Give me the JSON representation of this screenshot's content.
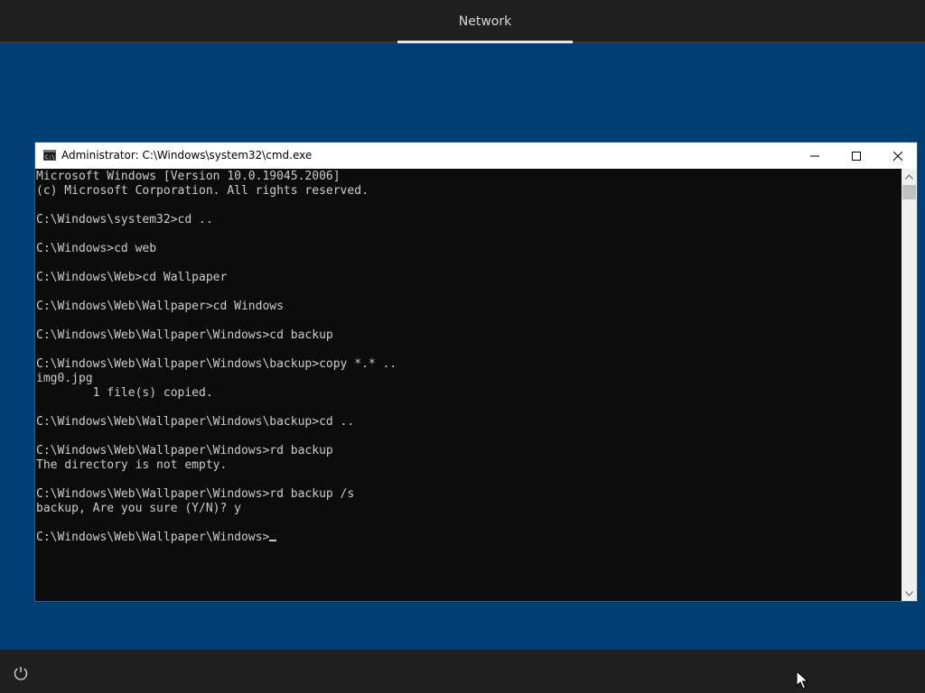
{
  "topbar": {
    "tab_label": "Network"
  },
  "window": {
    "title": "Administrator: C:\\Windows\\system32\\cmd.exe",
    "icon": "cmd-icon"
  },
  "console": {
    "lines": [
      "Microsoft Windows [Version 10.0.19045.2006]",
      "(c) Microsoft Corporation. All rights reserved.",
      "",
      "C:\\Windows\\system32>cd ..",
      "",
      "C:\\Windows>cd web",
      "",
      "C:\\Windows\\Web>cd Wallpaper",
      "",
      "C:\\Windows\\Web\\Wallpaper>cd Windows",
      "",
      "C:\\Windows\\Web\\Wallpaper\\Windows>cd backup",
      "",
      "C:\\Windows\\Web\\Wallpaper\\Windows\\backup>copy *.* ..",
      "img0.jpg",
      "        1 file(s) copied.",
      "",
      "C:\\Windows\\Web\\Wallpaper\\Windows\\backup>cd ..",
      "",
      "C:\\Windows\\Web\\Wallpaper\\Windows>rd backup",
      "The directory is not empty.",
      "",
      "C:\\Windows\\Web\\Wallpaper\\Windows>rd backup /s",
      "backup, Are you sure (Y/N)? y",
      ""
    ],
    "prompt": "C:\\Windows\\Web\\Wallpaper\\Windows>"
  },
  "icons": {
    "minimize": "minimize-icon",
    "maximize": "maximize-icon",
    "close": "close-icon",
    "power": "power-icon",
    "cursor": "mouse-pointer-icon"
  },
  "colors": {
    "desktop": "#003f73",
    "bar": "#1f1f1f",
    "console_bg": "#0c0c0c",
    "console_text": "#cccccc"
  }
}
